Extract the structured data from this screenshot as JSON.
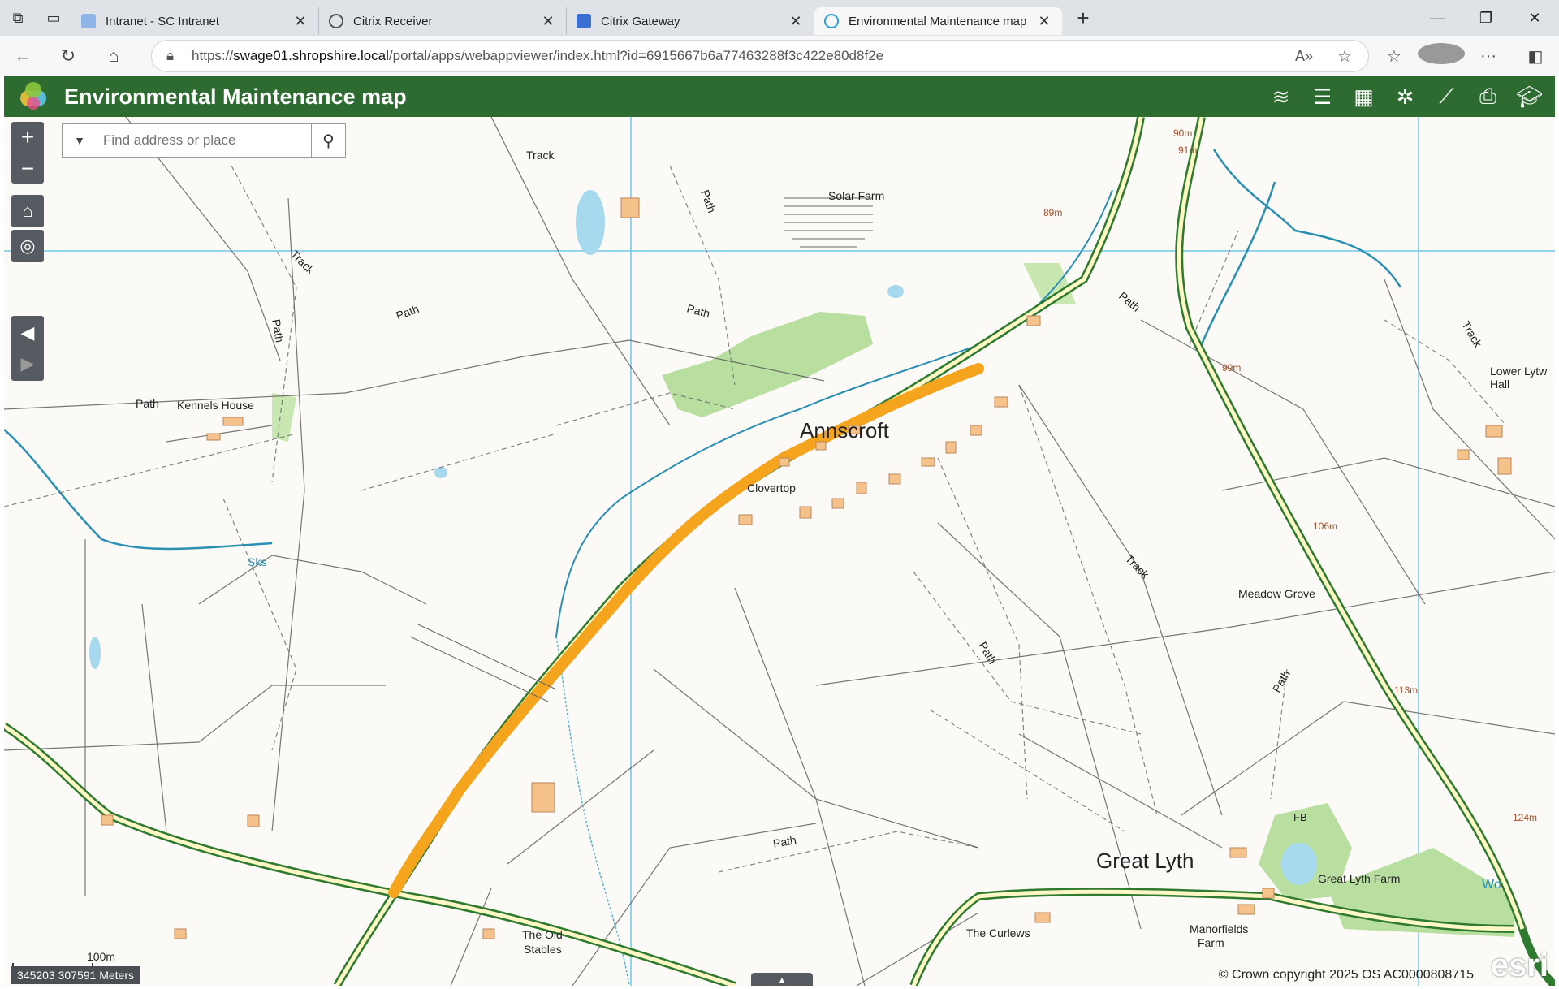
{
  "browser": {
    "tabs": [
      {
        "title": "Intranet - SC Intranet",
        "icon": "intranet-icon"
      },
      {
        "title": "Citrix Receiver",
        "icon": "citrix-icon"
      },
      {
        "title": "Citrix Gateway",
        "icon": "lock-icon"
      },
      {
        "title": "Environmental Maintenance map",
        "icon": "arcgis-icon",
        "active": true
      }
    ],
    "url": {
      "prefix": "https://",
      "host": "swage01.shropshire.local",
      "path": "/portal/apps/webappviewer/index.html?id=6915667b6a77463288f3c422e80d8f2e"
    }
  },
  "app": {
    "title": "Environmental Maintenance map",
    "header_color": "#2d6b31",
    "widgets": [
      "layer-list-icon",
      "legend-icon",
      "basemap-gallery-icon",
      "select-icon",
      "measure-icon",
      "print-icon",
      "about-icon"
    ]
  },
  "map": {
    "search_placeholder": "Find address or place",
    "scale_label": "100m",
    "coordinates": "345203 307591 Meters",
    "copyright": "© Crown copyright 2025 OS AC0000808715",
    "esri_logo": "esri",
    "highlight_color": "#f5a41e",
    "labels": {
      "annscroft": "Annscroft",
      "great_lyth": "Great Lyth",
      "clovertop": "Clovertop",
      "kennels_house": "Kennels House",
      "solar_farm": "Solar Farm",
      "meadow_grove": "Meadow Grove",
      "great_lyth_farm": "Great Lyth Farm",
      "the_curlews": "The Curlews",
      "manorfields_farm_1": "Manorfields",
      "manorfields_farm_2": "Farm",
      "the_old_stables_1": "The Old",
      "the_old_stables_2": "Stables",
      "lower_lyth_hall_1": "Lower Lytw",
      "lower_lyth_hall_2": "Hall",
      "track_1": "Track",
      "track_2": "Track",
      "track_3": "Track",
      "track_4": "Track",
      "path_1": "Path",
      "path_2": "Path",
      "path_3": "Path",
      "path_4": "Path",
      "path_5": "Path",
      "path_6": "Path",
      "path_7": "Path",
      "path_8": "Path",
      "path_9": "Path",
      "sks": "Sks",
      "fb": "FB",
      "wo": "Wo",
      "h90": "90m",
      "h91": "91m",
      "h89": "89m",
      "h99": "99m",
      "h106": "106m",
      "h113": "113m",
      "h124": "124m"
    }
  }
}
